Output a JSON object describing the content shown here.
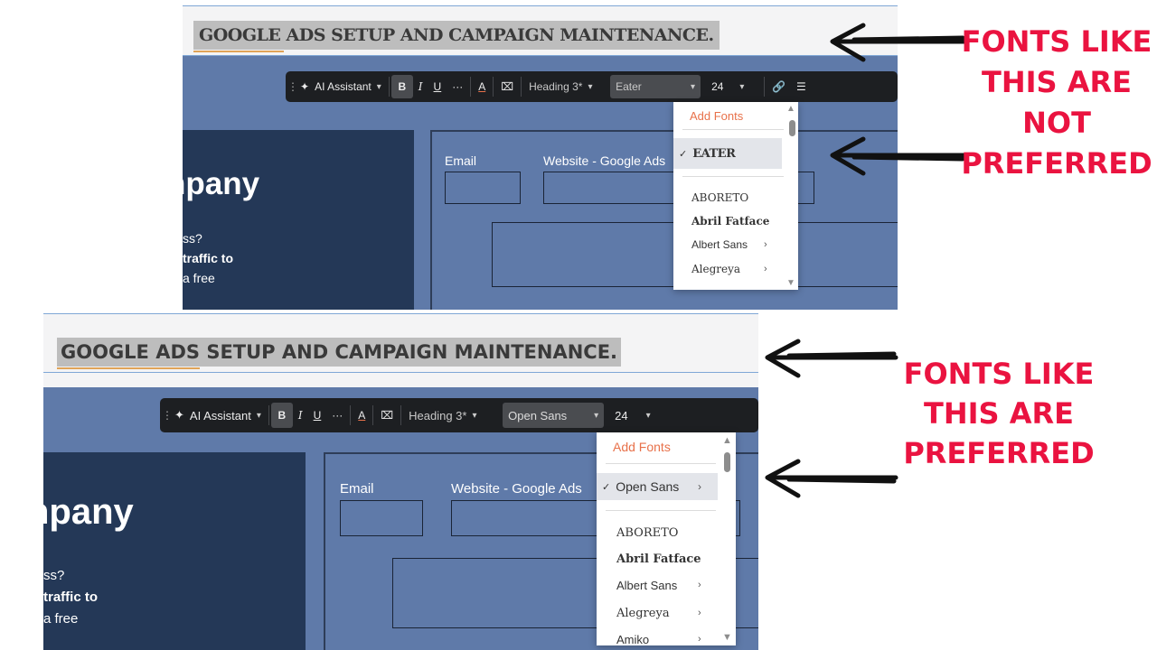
{
  "shot1": {
    "title": "GOOGLE ADS SETUP AND CAMPAIGN MAINTENANCE.",
    "toolbar": {
      "ai_label": "AI Assistant",
      "bold": "B",
      "italic": "I",
      "underline": "U",
      "more": "···",
      "text_color": "A",
      "clear": "⌧",
      "heading": "Heading 3*",
      "font": "Eater",
      "size": "24"
    },
    "dropdown": {
      "add": "Add Fonts",
      "selected": "EATER",
      "items": [
        "ABORETO",
        "Abril Fatface",
        "Albert Sans",
        "Alegreya"
      ]
    },
    "form": {
      "email": "Email",
      "website": "Website - Google Ads"
    },
    "panel": {
      "heading": "npany",
      "l1": "ss?",
      "l2": "traffic to",
      "l3": "a free"
    }
  },
  "shot2": {
    "title": "GOOGLE ADS SETUP AND CAMPAIGN MAINTENANCE.",
    "toolbar": {
      "ai_label": "AI Assistant",
      "bold": "B",
      "italic": "I",
      "underline": "U",
      "more": "···",
      "text_color": "A",
      "clear": "⌧",
      "heading": "Heading 3*",
      "font": "Open Sans",
      "size": "24"
    },
    "dropdown": {
      "add": "Add Fonts",
      "selected": "Open Sans",
      "items": [
        "ABORETO",
        "Abril Fatface",
        "Albert Sans",
        "Alegreya",
        "Amiko"
      ]
    },
    "form": {
      "email": "Email",
      "website": "Website - Google Ads"
    },
    "panel": {
      "heading": "npany",
      "l1": "ss?",
      "l2": "traffic to",
      "l3": "a free"
    }
  },
  "annotations": {
    "not_preferred": [
      "FONTS LIKE",
      "THIS ARE",
      "NOT",
      "PREFERRED"
    ],
    "preferred": [
      "FONTS LIKE",
      "THIS ARE",
      "PREFERRED"
    ],
    "accent_color": "#ea1340"
  },
  "colors": {
    "canvas": "#5f7aa9",
    "panel": "#243857",
    "toolbar": "#1d1f22",
    "add_fonts": "#e8714a"
  }
}
